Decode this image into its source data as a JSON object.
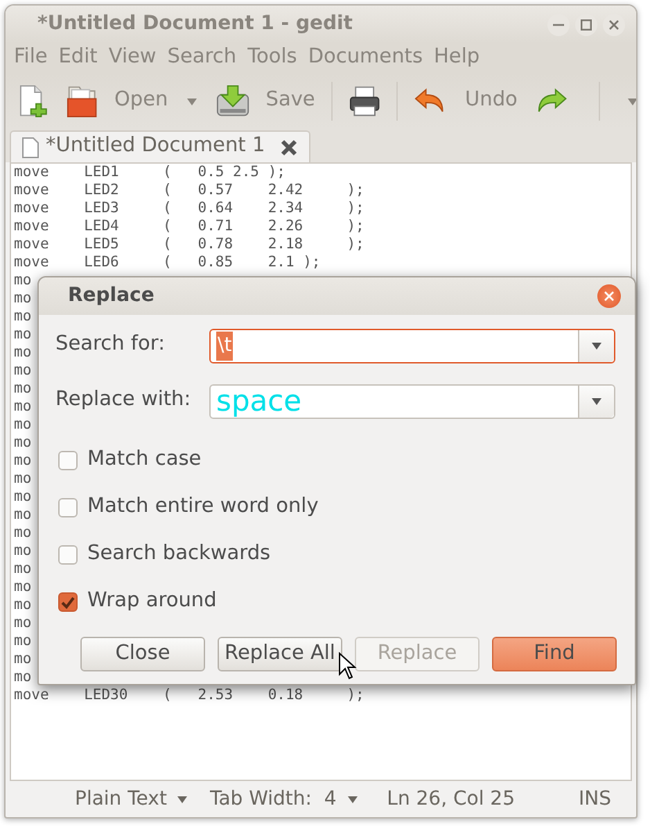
{
  "window": {
    "title": "*Untitled Document 1 - gedit"
  },
  "menu": [
    "File",
    "Edit",
    "View",
    "Search",
    "Tools",
    "Documents",
    "Help"
  ],
  "toolbar": {
    "open_label": "Open",
    "save_label": "Save",
    "undo_label": "Undo"
  },
  "tabs": [
    {
      "label": "*Untitled Document 1",
      "selected": true
    }
  ],
  "editor": {
    "lines_above": [
      "move    LED1     (   0.5 2.5 );",
      "move    LED2     (   0.57    2.42     );",
      "move    LED3     (   0.64    2.34     );",
      "move    LED4     (   0.71    2.26     );",
      "move    LED5     (   0.78    2.18     );",
      "move    LED6     (   0.85    2.1 );"
    ],
    "lines_covered": [
      "mo",
      "mo",
      "mo",
      "mo",
      "mo",
      "mo",
      "mo",
      "mo",
      "mo",
      "mo",
      "mo",
      "mo",
      "mo",
      "mo",
      "mo",
      "mo",
      "mo",
      "mo",
      "mo",
      "mo",
      "mo",
      "mo",
      "mo"
    ],
    "lines_below": [
      "move    LED30    (   2.53    0.18     );"
    ]
  },
  "dialog": {
    "title": "Replace",
    "fields": [
      {
        "label": "Search for:",
        "value": "\\t",
        "focused": true,
        "text_selected": true
      },
      {
        "label": "Replace with:",
        "value": "space",
        "focused": false,
        "text_selected": false
      }
    ],
    "options": [
      {
        "label": "Match case",
        "checked": false
      },
      {
        "label": "Match entire word only",
        "checked": false
      },
      {
        "label": "Search backwards",
        "checked": false
      },
      {
        "label": "Wrap around",
        "checked": true
      }
    ],
    "buttons": [
      {
        "label": "Close",
        "disabled": false,
        "default": false
      },
      {
        "label": "Replace All",
        "disabled": false,
        "default": false
      },
      {
        "label": "Replace",
        "disabled": true,
        "default": false
      },
      {
        "label": "Find",
        "disabled": false,
        "default": true
      }
    ]
  },
  "status_bar": {
    "language": "Plain Text",
    "tab_width": "Tab Width:  4",
    "position": "Ln 26, Col 25",
    "mode": "INS"
  }
}
